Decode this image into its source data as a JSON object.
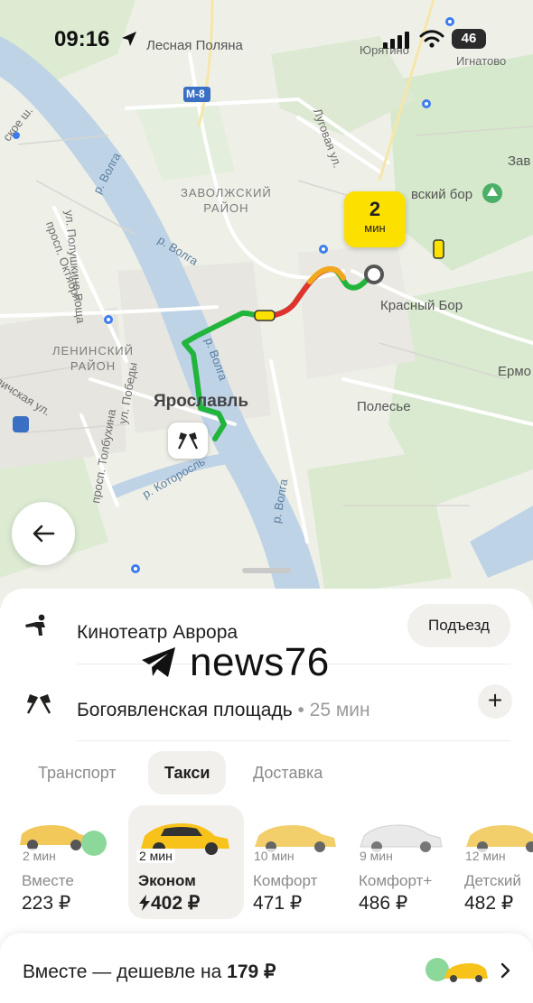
{
  "status_bar": {
    "time": "09:16",
    "battery": "46",
    "place_top": "Лесная Поляна",
    "place_top2": "Юрятино",
    "place_top3": "Игнатово"
  },
  "map": {
    "labels": {
      "m8": "M-8",
      "zavolzhsky": "ЗАВОЛЖСКИЙ\nРАЙОН",
      "leninsky": "ЛЕНИНСКИЙ\nРАЙОН",
      "yaroslavl": "Ярославль",
      "krasny_bor": "Красный Бор",
      "polesye": "Полесье",
      "krasny_bor_park": "вский бор",
      "zav": "Зав",
      "erm": "Ермо",
      "volga1": "р. Волга",
      "volga2": "р. Волга",
      "volga3": "р. Волга",
      "volga4": "р. Волга",
      "kotorosl": "р. Которосль",
      "lugovaya": "Луговая ул.",
      "polushkina": "ул. Полушкина Роща",
      "oktyabrya": "просп. Октября",
      "pobedy": "ул. Победы",
      "tolbukhina": "просп. Толбухина",
      "lichskaya": "личская ул.",
      "skoe": "ское ш."
    },
    "eta_badge": {
      "value": "2",
      "unit": "мин"
    }
  },
  "route": {
    "from": "Кинотеатр Аврора",
    "entrance_button": "Подъезд",
    "to": "Богоявленская площадь",
    "to_duration": " • 25 мин",
    "add_stop": "+"
  },
  "watermark": {
    "text": "news76"
  },
  "tabs": [
    {
      "label": "Транспорт",
      "active": false
    },
    {
      "label": "Такси",
      "active": true
    },
    {
      "label": "Доставка",
      "active": false
    }
  ],
  "tariffs": [
    {
      "name": "Вместе",
      "eta": "2 мин",
      "price": "223 ₽",
      "selected": false,
      "car_color": "#f2c85a"
    },
    {
      "name": "Эконом",
      "eta": "2 мин",
      "price": "402 ₽",
      "selected": true,
      "car_color": "#f7c21a",
      "surge_icon": "lightning-icon"
    },
    {
      "name": "Комфорт",
      "eta": "10 мин",
      "price": "471 ₽",
      "selected": false,
      "car_color": "#f2cf6a"
    },
    {
      "name": "Комфорт+",
      "eta": "9 мин",
      "price": "486 ₽",
      "selected": false,
      "car_color": "#e9e9e9"
    },
    {
      "name": "Детский",
      "eta": "12 мин",
      "price": "482 ₽",
      "selected": false,
      "car_color": "#f2cf6a"
    }
  ],
  "promo": {
    "text": "Вместе — дешевле на ",
    "amount": "179 ₽"
  },
  "colors": {
    "accent_yellow": "#fce000",
    "route_green": "#22b53c",
    "route_red": "#e0332f",
    "water": "#bfd3e6"
  }
}
